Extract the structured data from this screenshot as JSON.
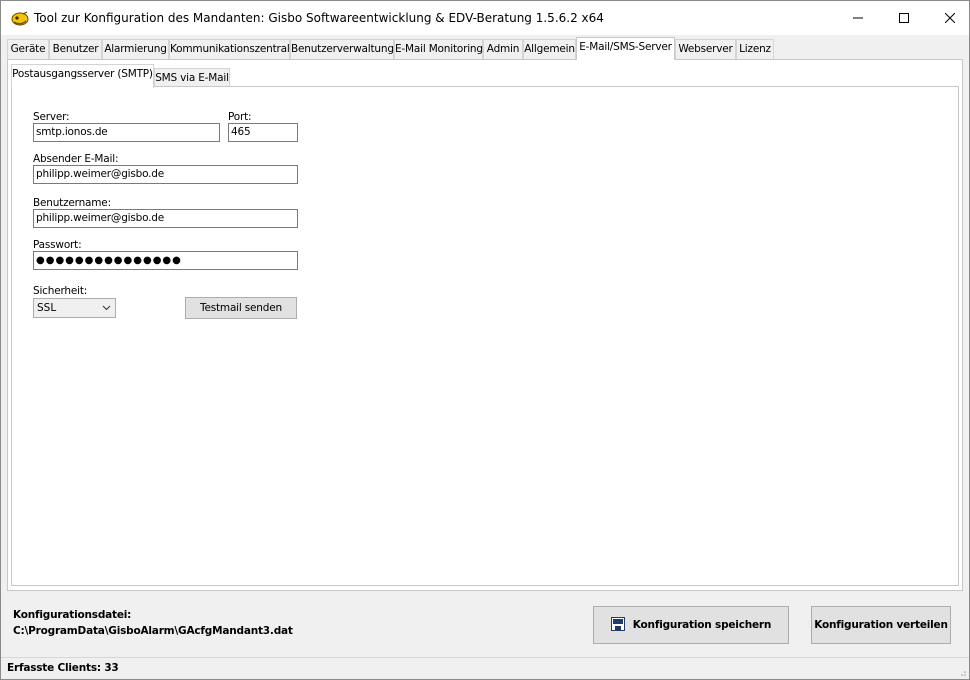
{
  "window": {
    "title": "Tool zur Konfiguration des Mandanten: Gisbo Softwareentwicklung & EDV-Beratung 1.5.6.2 x64",
    "minimize_icon": "minimize-icon",
    "maximize_icon": "maximize-icon",
    "close_icon": "close-icon"
  },
  "tabs": [
    {
      "label": "Geräte"
    },
    {
      "label": "Benutzer"
    },
    {
      "label": "Alarmierung"
    },
    {
      "label": "Kommunikationszentrale"
    },
    {
      "label": "Benutzerverwaltung"
    },
    {
      "label": "E-Mail Monitoring"
    },
    {
      "label": "Admin"
    },
    {
      "label": "Allgemein"
    },
    {
      "label": "E-Mail/SMS-Server",
      "active": true
    },
    {
      "label": "Webserver"
    },
    {
      "label": "Lizenz"
    }
  ],
  "subtabs": [
    {
      "label": "Postausgangsserver (SMTP)",
      "active": true
    },
    {
      "label": "SMS via E-Mail"
    }
  ],
  "smtp": {
    "server_label": "Server:",
    "server_value": "smtp.ionos.de",
    "port_label": "Port:",
    "port_value": "465",
    "sender_label": "Absender E-Mail:",
    "sender_value": "philipp.weimer@gisbo.de",
    "username_label": "Benutzername:",
    "username_value": "philipp.weimer@gisbo.de",
    "password_label": "Passwort:",
    "password_value": "●●●●●●●●●●●●●●●",
    "security_label": "Sicherheit:",
    "security_value": "SSL",
    "testmail_button": "Testmail senden"
  },
  "footer": {
    "config_file_label": "Konfigurationsdatei:",
    "config_file_path": "C:\\ProgramData\\GisboAlarm\\GAcfgMandant3.dat",
    "save_button": "Konfiguration speichern",
    "distribute_button": "Konfiguration verteilen"
  },
  "status": {
    "text": "Erfasste Clients: 33"
  }
}
